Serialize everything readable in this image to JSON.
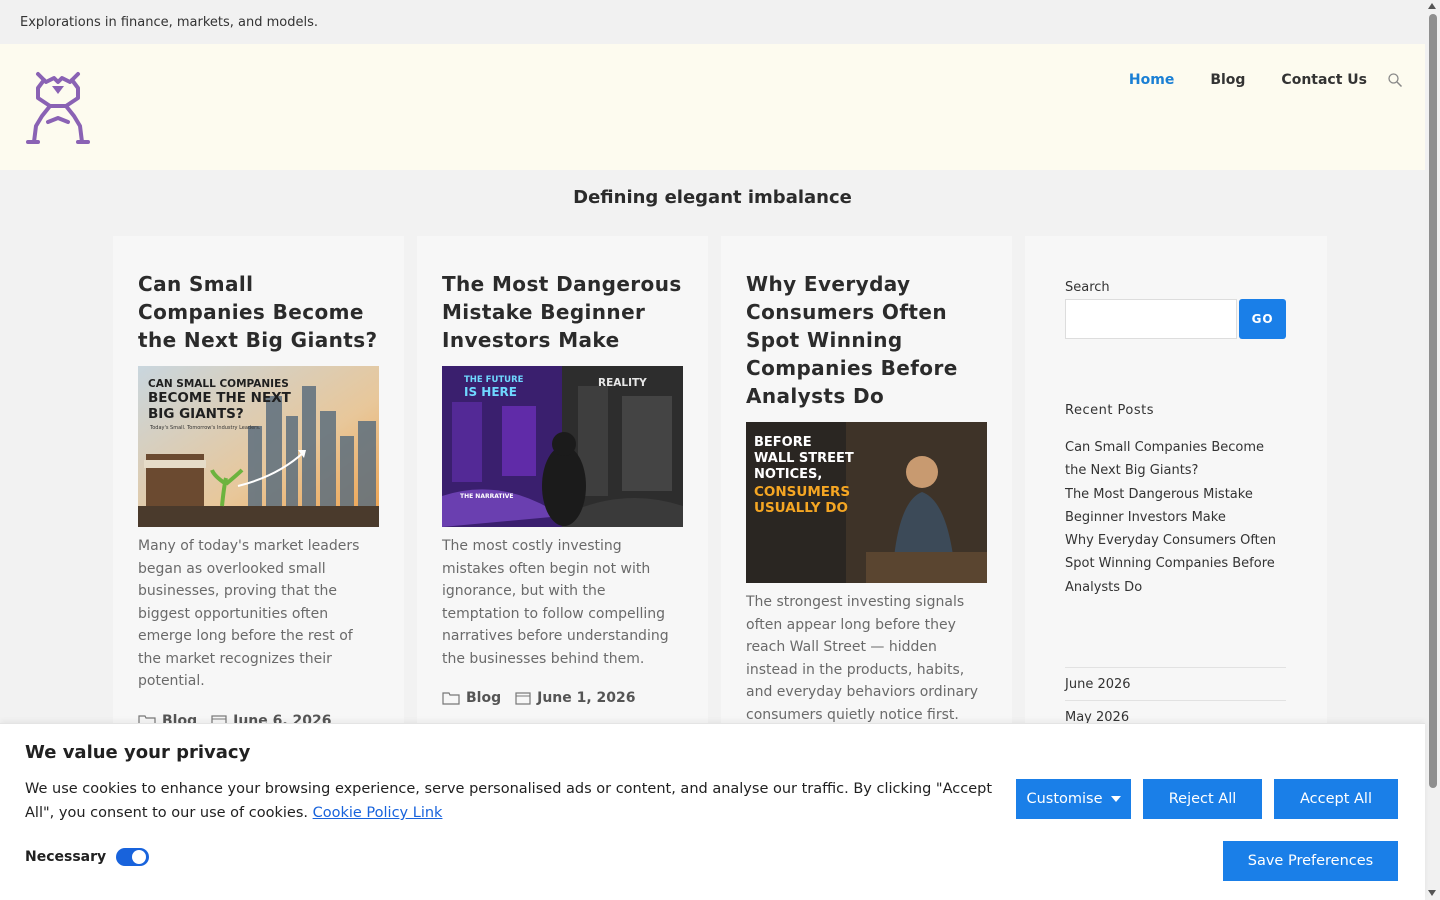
{
  "site": {
    "description": "Explorations in finance, markets, and models.",
    "tagline": "Defining elegant imbalance"
  },
  "nav": {
    "items": [
      {
        "label": "Home",
        "active": true
      },
      {
        "label": "Blog",
        "active": false
      },
      {
        "label": "Contact Us",
        "active": false
      }
    ]
  },
  "posts": [
    {
      "title": "Can Small Companies Become the Next Big Giants?",
      "image_text": {
        "line1": "CAN SMALL COMPANIES",
        "line2": "BECOME THE NEXT",
        "line3": "BIG GIANTS?",
        "sub": "Today's Small. Tomorrow's Industry Leaders."
      },
      "excerpt": "Many of today's market leaders began as overlooked small businesses, proving that the biggest opportunities often emerge long before the rest of the market recognizes their potential.",
      "category": "Blog",
      "date": "June 6, 2026"
    },
    {
      "title": "The Most Dangerous Mistake Beginner Investors Make",
      "image_text": {
        "line1": "THE FUTURE",
        "line2": "IS HERE",
        "line3": "REALITY",
        "sub": "THE NARRATIVE"
      },
      "excerpt": "The most costly investing mistakes often begin not with ignorance, but with the temptation to follow compelling narratives before understanding the businesses behind them.",
      "category": "Blog",
      "date": "June 1, 2026"
    },
    {
      "title": "Why Everyday Consumers Often Spot Winning Companies Before Analysts Do",
      "image_text": {
        "line1": "BEFORE",
        "line2": "WALL STREET",
        "line3": "NOTICES,",
        "line4": "CONSUMERS",
        "line5": "USUALLY DO"
      },
      "excerpt": "The strongest investing signals often appear long before they reach Wall Street — hidden instead in the products, habits, and everyday behaviors ordinary consumers quietly notice first."
    }
  ],
  "sidebar": {
    "search_label": "Search",
    "search_button": "GO",
    "search_value": "",
    "recent_title": "Recent Posts",
    "recent": [
      "Can Small Companies Become the Next Big Giants?",
      "The Most Dangerous Mistake Beginner Investors Make",
      "Why Everyday Consumers Often Spot Winning Companies Before Analysts Do"
    ],
    "archives": [
      "June 2026",
      "May 2026"
    ]
  },
  "cookie": {
    "title": "We value your privacy",
    "text": "We use cookies to enhance your browsing experience, serve personalised ads or content, and analyse our traffic. By clicking \"Accept All\", you consent to our use of cookies.",
    "link": "Cookie Policy Link",
    "necessary_label": "Necessary",
    "necessary_on": true,
    "customise": "Customise",
    "reject": "Reject All",
    "accept": "Accept All",
    "save": "Save Preferences"
  },
  "colors": {
    "accent": "#1a7fe8",
    "nav_active": "#1a7fd4",
    "logo": "#8a62b4",
    "header_bg": "#fdfbef"
  }
}
